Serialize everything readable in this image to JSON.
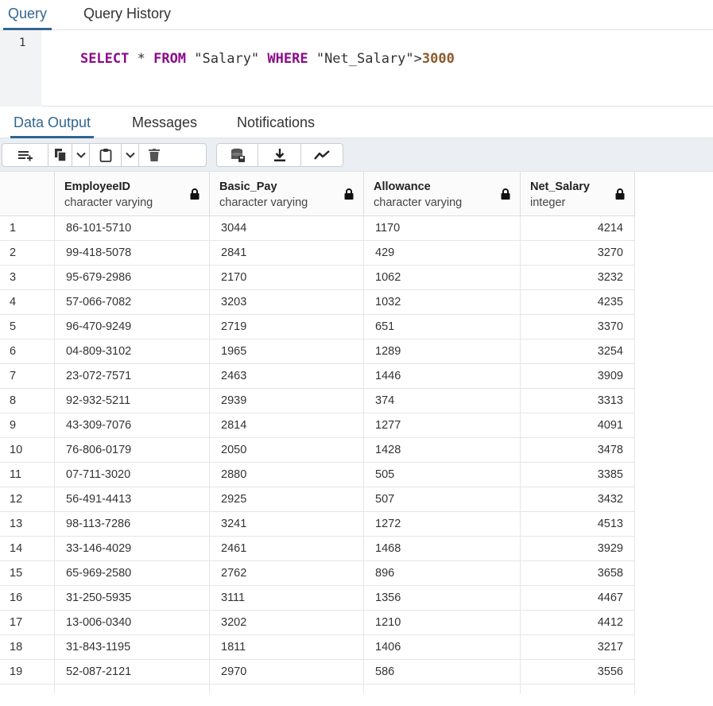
{
  "top_tabs": [
    {
      "label": "Query",
      "active": true
    },
    {
      "label": "Query History",
      "active": false
    }
  ],
  "editor": {
    "line_number": "1",
    "tokens": [
      {
        "text": "SELECT",
        "kind": "kw"
      },
      {
        "text": " * ",
        "kind": "plain"
      },
      {
        "text": "FROM",
        "kind": "kw"
      },
      {
        "text": " \"Salary\" ",
        "kind": "str"
      },
      {
        "text": "WHERE",
        "kind": "kw"
      },
      {
        "text": " \"Net_Salary\">",
        "kind": "str"
      },
      {
        "text": "3000",
        "kind": "num"
      }
    ]
  },
  "output_tabs": [
    {
      "label": "Data Output",
      "active": true
    },
    {
      "label": "Messages",
      "active": false
    },
    {
      "label": "Notifications",
      "active": false
    }
  ],
  "toolbar": {
    "icons": [
      "add-row-icon",
      "copy-icon",
      "chevron-down-icon",
      "paste-icon",
      "chevron-down-icon",
      "delete-icon",
      "save-data-icon",
      "download-icon",
      "graph-visualiser-icon"
    ]
  },
  "columns": [
    {
      "name": "EmployeeID",
      "type": "character varying"
    },
    {
      "name": "Basic_Pay",
      "type": "character varying"
    },
    {
      "name": "Allowance",
      "type": "character varying"
    },
    {
      "name": "Net_Salary",
      "type": "integer"
    }
  ],
  "rows": [
    [
      "1",
      "86-101-5710",
      "3044",
      "1170",
      "4214"
    ],
    [
      "2",
      "99-418-5078",
      "2841",
      "429",
      "3270"
    ],
    [
      "3",
      "95-679-2986",
      "2170",
      "1062",
      "3232"
    ],
    [
      "4",
      "57-066-7082",
      "3203",
      "1032",
      "4235"
    ],
    [
      "5",
      "96-470-9249",
      "2719",
      "651",
      "3370"
    ],
    [
      "6",
      "04-809-3102",
      "1965",
      "1289",
      "3254"
    ],
    [
      "7",
      "23-072-7571",
      "2463",
      "1446",
      "3909"
    ],
    [
      "8",
      "92-932-5211",
      "2939",
      "374",
      "3313"
    ],
    [
      "9",
      "43-309-7076",
      "2814",
      "1277",
      "4091"
    ],
    [
      "10",
      "76-806-0179",
      "2050",
      "1428",
      "3478"
    ],
    [
      "11",
      "07-711-3020",
      "2880",
      "505",
      "3385"
    ],
    [
      "12",
      "56-491-4413",
      "2925",
      "507",
      "3432"
    ],
    [
      "13",
      "98-113-7286",
      "3241",
      "1272",
      "4513"
    ],
    [
      "14",
      "33-146-4029",
      "2461",
      "1468",
      "3929"
    ],
    [
      "15",
      "65-969-2580",
      "2762",
      "896",
      "3658"
    ],
    [
      "16",
      "31-250-5935",
      "3111",
      "1356",
      "4467"
    ],
    [
      "17",
      "13-006-0340",
      "3202",
      "1210",
      "4412"
    ],
    [
      "18",
      "31-843-1195",
      "1811",
      "1406",
      "3217"
    ],
    [
      "19",
      "52-087-2121",
      "2970",
      "586",
      "3556"
    ]
  ],
  "colors": {
    "accent": "#326690",
    "keyword": "#8b0a8b",
    "number": "#8b5a2b"
  }
}
